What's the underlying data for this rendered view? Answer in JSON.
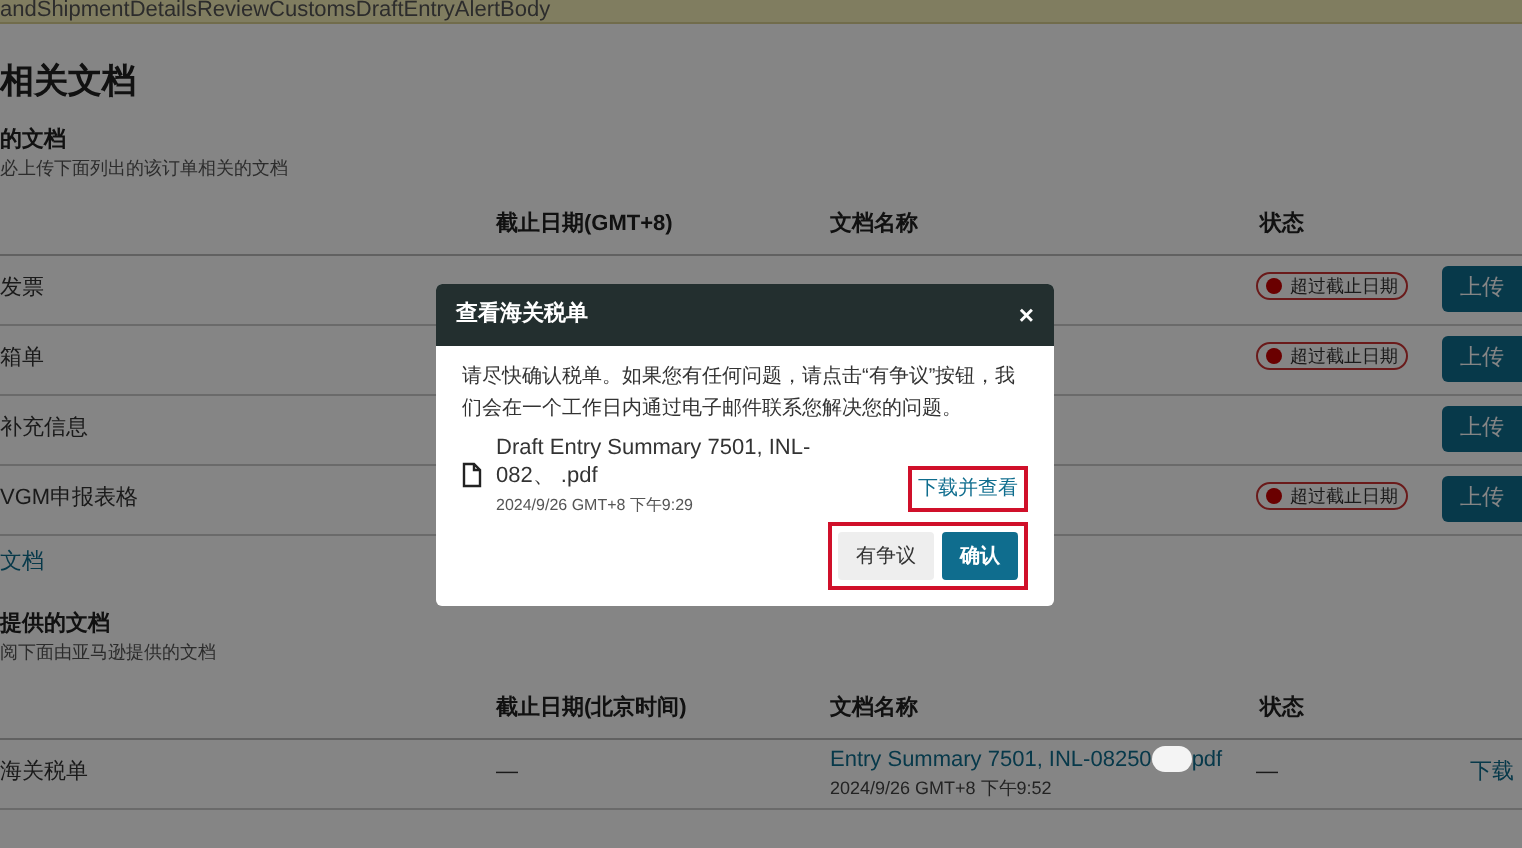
{
  "alert_bar": {
    "text": "andShipmentDetailsReviewCustomsDraftEntryAlertBody"
  },
  "page_title": "相关文档",
  "sections": [
    {
      "title": "的文档",
      "subtitle": "必上传下面列出的该订单相关的文档",
      "columns": [
        "截止日期(GMT+8)",
        "文档名称",
        "状态"
      ],
      "rows": [
        {
          "name": "发票",
          "status": "超过截止日期",
          "action": {
            "kind": "button",
            "label": "上传"
          }
        },
        {
          "name": "箱单",
          "status": "超过截止日期",
          "action": {
            "kind": "button",
            "label": "上传"
          }
        },
        {
          "name": "补充信息",
          "action": {
            "kind": "button",
            "label": "上传"
          }
        },
        {
          "name": "VGM申报表格",
          "status": "超过截止日期",
          "action": {
            "kind": "button",
            "label": "上传"
          }
        }
      ],
      "link": "文档"
    },
    {
      "title": "提供的文档",
      "subtitle": "阅下面由亚马逊提供的文档",
      "columns": [
        "截止日期(北京时间)",
        "文档名称",
        "状态"
      ],
      "rows": [
        {
          "name": "海关税单",
          "deadline": "—",
          "document": {
            "name_start": "Entry Summary 7501, INL-08250",
            "name_end": "pdf",
            "date": "2024/9/26 GMT+8 下午9:52"
          },
          "status_text": "—",
          "action": {
            "kind": "link",
            "label": "下载"
          }
        }
      ]
    }
  ],
  "dialog": {
    "title": "查看海关税单",
    "close": "×",
    "message": "请尽快确认税单。如果您有任何问题，请点击“有争议”按钮，我们会在一个工作日内通过电子邮件联系您解决您的问题。",
    "file": {
      "name": "Draft Entry Summary 7501, INL-082、 .pdf",
      "date": "2024/9/26 GMT+8 下午9:29"
    },
    "download": {
      "label": "下载并查看",
      "highlighted": true
    },
    "actions_highlighted": true,
    "buttons": [
      {
        "label": "有争议",
        "kind": "secondary"
      },
      {
        "label": "确认",
        "kind": "primary"
      }
    ]
  }
}
